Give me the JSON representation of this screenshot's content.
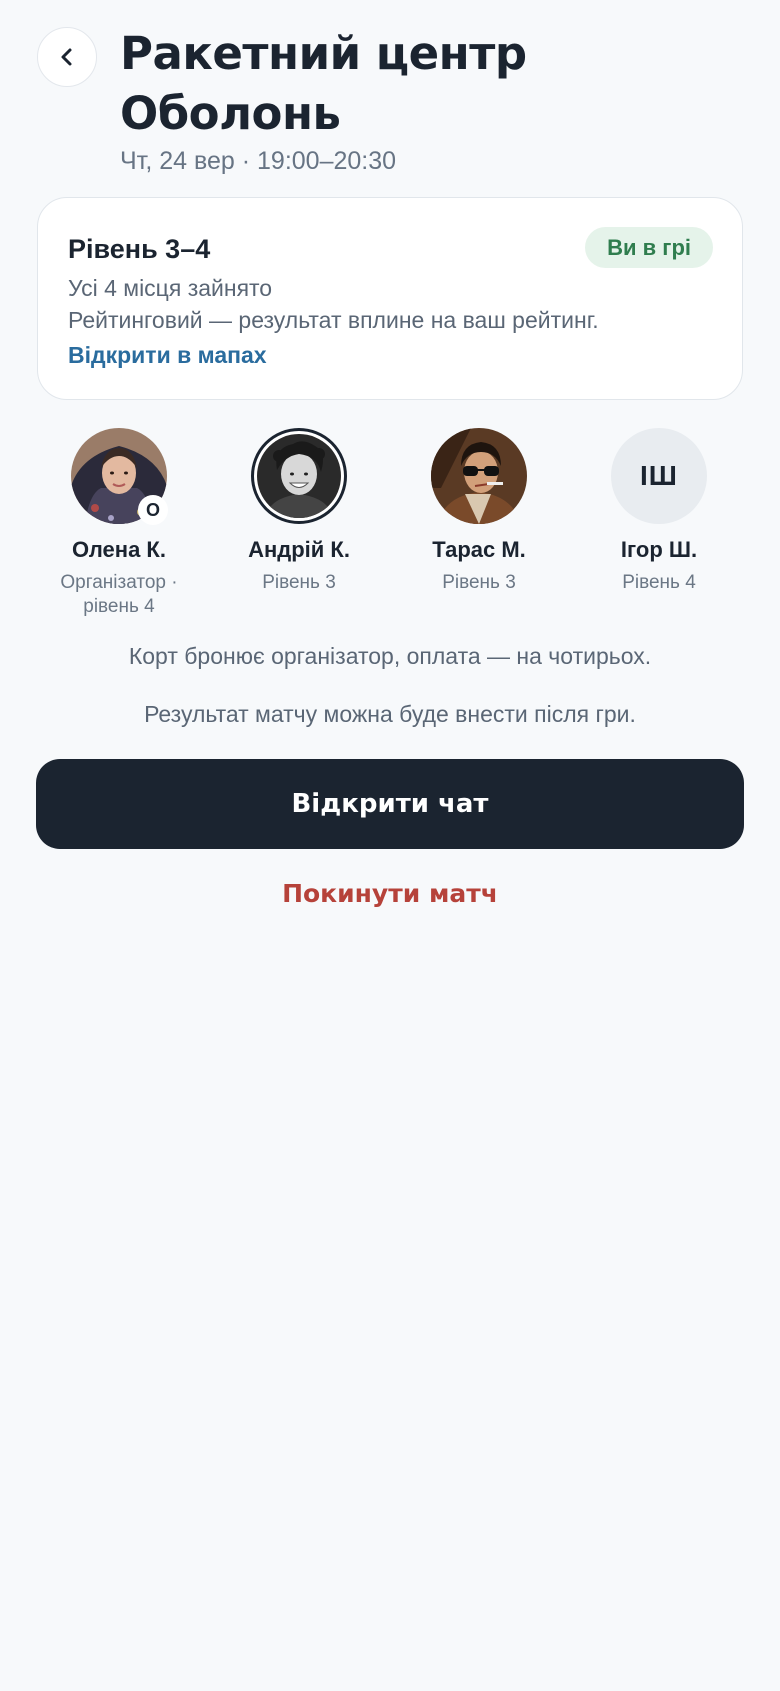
{
  "header": {
    "title": "Ракетний центр Оболонь",
    "datetime": "Чт, 24 вер · 19:00–20:30",
    "back_icon": "chevron-left-icon"
  },
  "card": {
    "level": "Рівень 3–4",
    "status_badge": "Ви в грі",
    "spots": "Усі 4 місця зайнято",
    "rating_note": "Рейтинговий — результат вплине на ваш рейтинг.",
    "map_link": "Відкрити в мапах"
  },
  "players": [
    {
      "name": "Олена К.",
      "subtitle": "Організатор · рівень 4",
      "badge": "О"
    },
    {
      "name": "Андрій К.",
      "subtitle": "Рівень 3"
    },
    {
      "name": "Тарас М.",
      "subtitle": "Рівень 3"
    },
    {
      "name": "Ігор Ш.",
      "subtitle": "Рівень 4",
      "initials": "ІШ"
    }
  ],
  "notes": {
    "booking": "Корт бронює організатор, оплата — на чотирьох.",
    "result": "Результат матчу можна буде внести після гри."
  },
  "actions": {
    "open_chat": "Відкрити чат",
    "leave_match": "Покинути матч"
  },
  "colors": {
    "primary": "#1b2430",
    "background": "#f7f9fb",
    "badge_bg": "#e5f3ea",
    "badge_text": "#2f7d4e",
    "link": "#2a6c9e",
    "danger": "#b6423a"
  }
}
